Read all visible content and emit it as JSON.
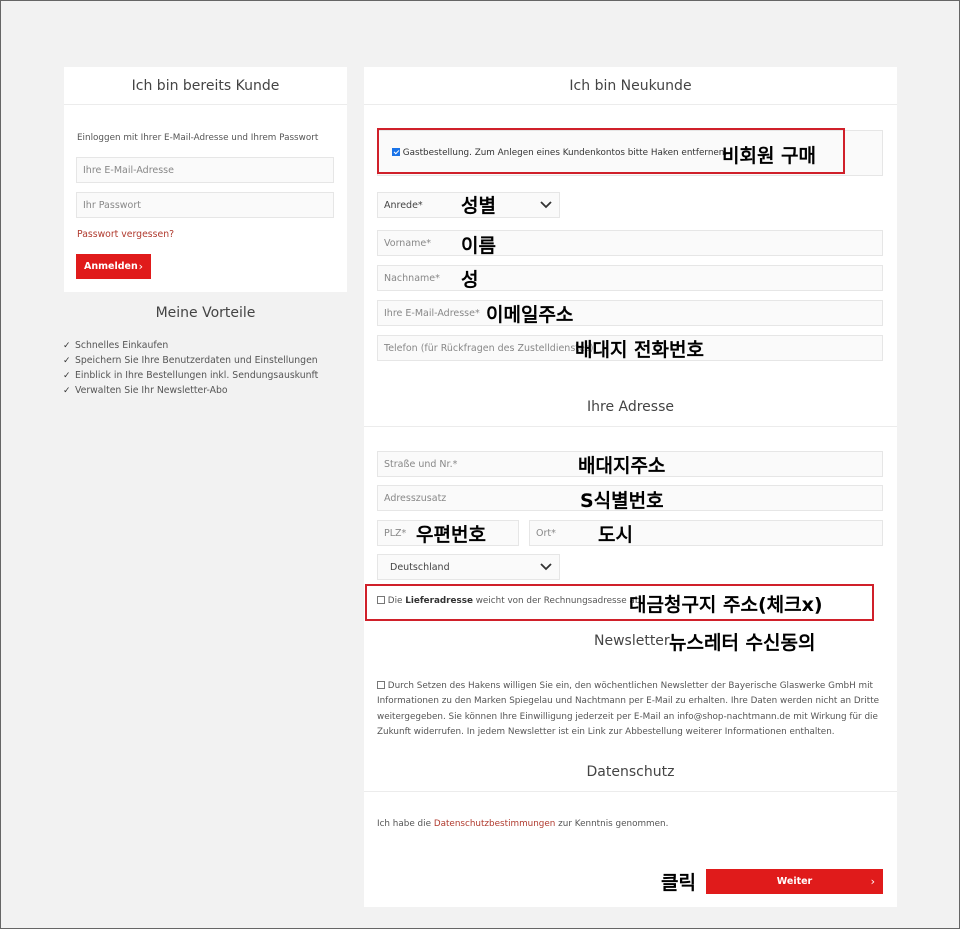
{
  "left_panel": {
    "title": "Ich bin bereits Kunde",
    "intro": "Einloggen mit Ihrer E-Mail-Adresse und Ihrem Passwort",
    "email_placeholder": "Ihre E-Mail-Adresse",
    "password_placeholder": "Ihr Passwort",
    "forgot_link": "Passwort vergessen?",
    "login_button": "Anmelden",
    "button_arrow": "›"
  },
  "benefits": {
    "title": "Meine Vorteile",
    "check": "✓",
    "items": [
      "Schnelles Einkaufen",
      "Speichern Sie Ihre Benutzerdaten und Einstellungen",
      "Einblick in Ihre Bestellungen inkl. Sendungsauskunft",
      "Verwalten Sie Ihr Newsletter-Abo"
    ]
  },
  "right_panel": {
    "title": "Ich bin Neukunde",
    "guest_checkbox_label": "Gastbestellung. Zum Anlegen eines Kundenkontos bitte Haken entfernen.",
    "salutation": "Anrede*",
    "first_name": "Vorname*",
    "last_name": "Nachname*",
    "email": "Ihre E-Mail-Adresse*",
    "phone": "Telefon (für Rückfragen des Zustelldienstes)",
    "address_title": "Ihre Adresse",
    "street": "Straße und Nr.*",
    "address_extra": "Adresszusatz",
    "zip": "PLZ*",
    "city": "Ort*",
    "country": "Deutschland",
    "delivery_prefix": "Die ",
    "delivery_bold": "Lieferadresse",
    "delivery_suffix": " weicht von der Rechnungsadresse ab.",
    "newsletter_title": "Newsletter",
    "newsletter_text": "Durch Setzen des Hakens willigen Sie ein, den wöchentlichen Newsletter der Bayerische Glaswerke GmbH mit Informationen zu den Marken Spiegelau und Nachtmann per E-Mail zu erhalten. Ihre Daten werden nicht an Dritte weitergegeben. Sie können Ihre Einwilligung jederzeit per E-Mail an info@shop-nachtmann.de mit Wirkung für die Zukunft widerrufen. In jedem Newsletter ist ein Link zur Abbestellung weiterer Informationen enthalten.",
    "privacy_title": "Datenschutz",
    "privacy_prefix": "Ich habe die ",
    "privacy_link": "Datenschutzbestimmungen",
    "privacy_suffix": " zur Kenntnis genommen.",
    "continue_button": "Weiter",
    "button_arrow": "›"
  },
  "annotations": {
    "guest": "비회원 구매",
    "salutation": "성별",
    "first_name": "이름",
    "last_name": "성",
    "email": "이메일주소",
    "phone": "배대지 전화번호",
    "street": "배대지주소",
    "address_extra": "S식별번호",
    "zip": "우편번호",
    "city": "도시",
    "billing": "대금청구지 주소(체크x)",
    "newsletter": "뉴스레터 수신동의",
    "click": "클릭"
  },
  "colors": {
    "accent_red": "#e01b1b",
    "link": "#b03a2e",
    "annotation_box": "#d0202a"
  }
}
